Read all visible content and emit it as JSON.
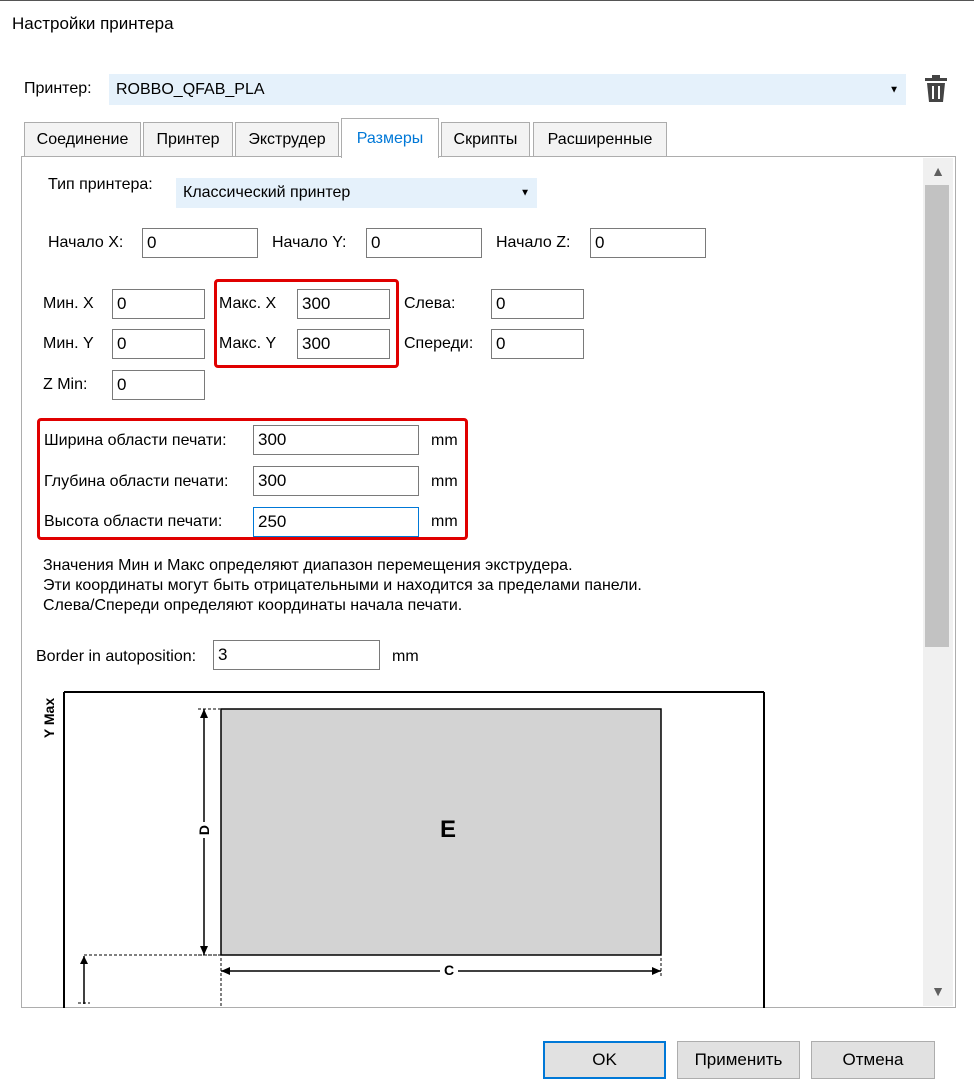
{
  "window": {
    "title": "Настройки принтера"
  },
  "printer": {
    "label": "Принтер:",
    "value": "ROBBO_QFAB_PLA"
  },
  "icons": {
    "delete": "trash-icon",
    "dropdown": "chevron-down-icon"
  },
  "tabs": [
    {
      "label": "Соединение",
      "active": false
    },
    {
      "label": "Принтер",
      "active": false
    },
    {
      "label": "Экструдер",
      "active": false
    },
    {
      "label": "Размеры",
      "active": true
    },
    {
      "label": "Скрипты",
      "active": false
    },
    {
      "label": "Расширенные",
      "active": false
    }
  ],
  "dimensions": {
    "printer_type": {
      "label": "Тип принтера:",
      "value": "Классический принтер"
    },
    "start_x": {
      "label": "Начало X:",
      "value": "0"
    },
    "start_y": {
      "label": "Начало Y:",
      "value": "0"
    },
    "start_z": {
      "label": "Начало Z:",
      "value": "0"
    },
    "min_x": {
      "label": "Мин. X",
      "value": "0"
    },
    "min_y": {
      "label": "Мин. Y",
      "value": "0"
    },
    "max_x": {
      "label": "Макс. X",
      "value": "300"
    },
    "max_y": {
      "label": "Макс. Y",
      "value": "300"
    },
    "left": {
      "label": "Слева:",
      "value": "0"
    },
    "front": {
      "label": "Спереди:",
      "value": "0"
    },
    "z_min": {
      "label": "Z Min:",
      "value": "0"
    },
    "print_width": {
      "label": "Ширина области печати:",
      "value": "300",
      "unit": "mm"
    },
    "print_depth": {
      "label": "Глубина области печати:",
      "value": "300",
      "unit": "mm"
    },
    "print_height": {
      "label": "Высота области печати:",
      "value": "250",
      "unit": "mm"
    },
    "info_lines": [
      "Значения Мин и Макс определяют диапазон перемещения экструдера.",
      "Эти координаты могут быть отрицательными и находится за пределами панели.",
      "Слева/Спереди определяют координаты начала печати."
    ],
    "border_autoposition": {
      "label": "Border in autoposition:",
      "value": "3",
      "unit": "mm"
    }
  },
  "diagram": {
    "y_max_label": "Y Max",
    "area_label": "E",
    "depth_label": "D",
    "width_label": "C"
  },
  "buttons": {
    "ok": "OK",
    "apply": "Применить",
    "cancel": "Отмена"
  },
  "colors": {
    "accent": "#0078d7",
    "highlight": "#e00000",
    "print_area": "#d3d3d3"
  }
}
